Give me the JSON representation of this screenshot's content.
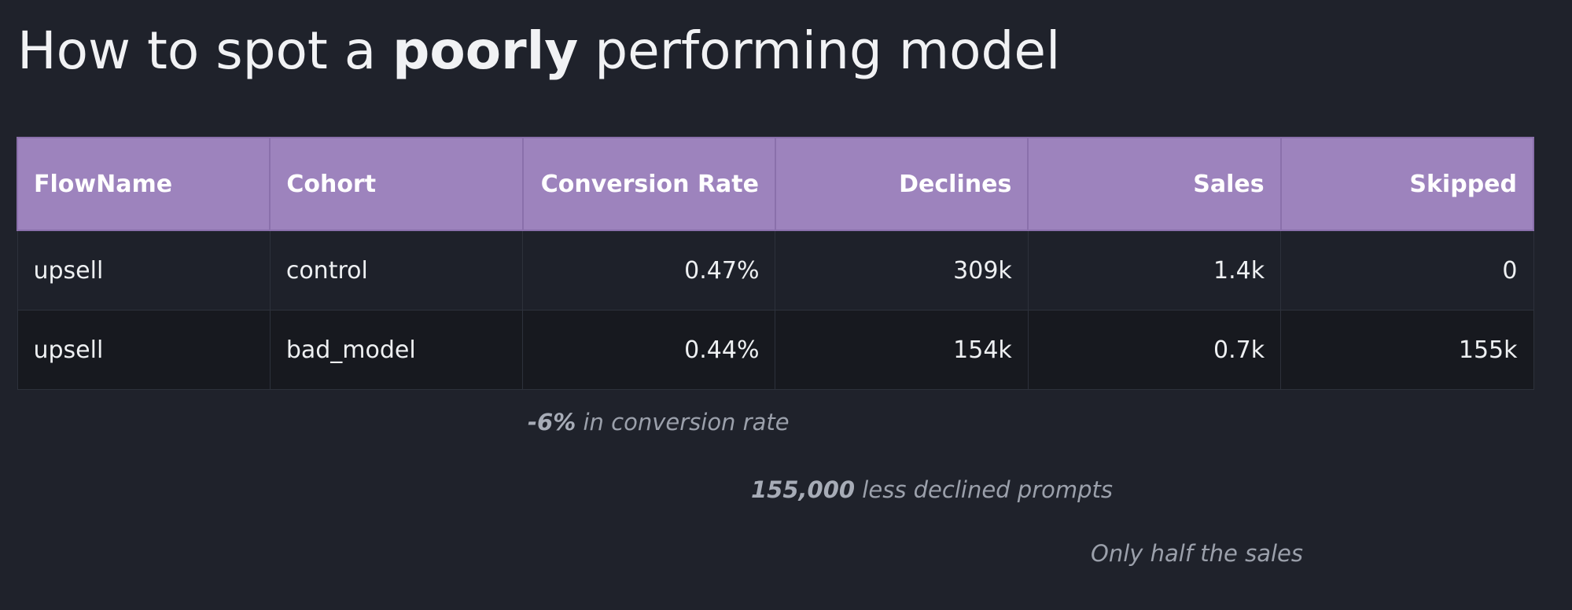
{
  "title": {
    "prefix": "How to spot a ",
    "emphasis": "poorly",
    "suffix": " performing model"
  },
  "table": {
    "headers": [
      "FlowName",
      "Cohort",
      "Conversion Rate",
      "Declines",
      "Sales",
      "Skipped"
    ],
    "rows": [
      [
        "upsell",
        "control",
        "0.47%",
        "309k",
        "1.4k",
        "0"
      ],
      [
        "upsell",
        "bad_model",
        "0.44%",
        "154k",
        "0.7k",
        "155k"
      ]
    ]
  },
  "notes": [
    {
      "strong": "-6%",
      "text": " in conversion rate"
    },
    {
      "strong": "155,000",
      "text": " less declined prompts"
    },
    {
      "strong": "",
      "text": "Only half the sales"
    }
  ]
}
